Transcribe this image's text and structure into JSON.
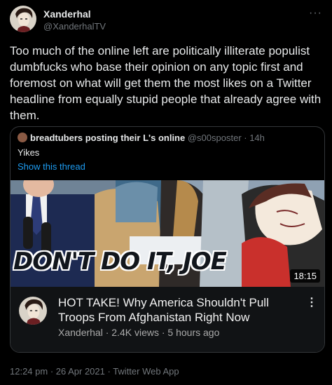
{
  "tweet": {
    "author_name": "Xanderhal",
    "author_handle": "@XanderhalTV",
    "more_icon": "···",
    "text": "Too much of the online left are politically illiterate populist dumbfucks who base their opinion on any topic first and foremost on what will get them the most likes on a Twitter headline from equally stupid people that already agree with them.",
    "footer": "12:24 pm · 26 Apr 2021 · Twitter Web App"
  },
  "quote": {
    "author_name": "breadtubers posting their L's online",
    "author_handle": "@s00sposter · 14h",
    "text": "Yikes",
    "show_thread": "Show this thread"
  },
  "video": {
    "thumbnail_title": "DON'T DO IT, JOE",
    "duration": "18:15",
    "title": "HOT TAKE! Why America Shouldn't Pull Troops From Afghanistan Right Now",
    "meta": "Xanderhal · 2.4K views · 5 hours ago",
    "kebab_icon": "⋮"
  },
  "colors": {
    "background": "#000000",
    "text": "#e7e9ea",
    "muted": "#71767b",
    "link": "#1d9bf0"
  }
}
